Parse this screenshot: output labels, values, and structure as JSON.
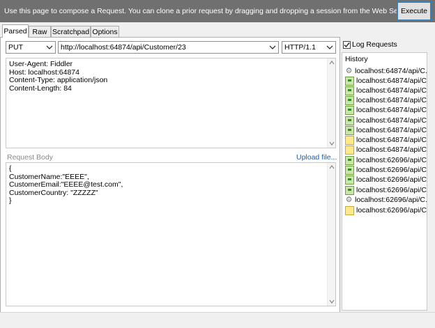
{
  "banner": {
    "text": "Use this page to compose a Request. You can clone a prior request by dragging and dropping a session from the Web Sessions list.",
    "execute_label": "Execute"
  },
  "tabs": [
    {
      "label": "Parsed",
      "active": true
    },
    {
      "label": "Raw",
      "active": false
    },
    {
      "label": "Scratchpad",
      "active": false
    },
    {
      "label": "Options",
      "active": false
    }
  ],
  "request_line": {
    "method": "PUT",
    "url": "http://localhost:64874/api/Customer/23",
    "version": "HTTP/1.1"
  },
  "headers_text": "User-Agent: Fiddler\nHost: localhost:64874\nContent-Type: application/json\nContent-Length: 84",
  "body": {
    "label": "Request Body",
    "upload_label": "Upload file...",
    "text": "{\nCustomerName:\"EEEE\",\nCustomerEmail:\"EEEE@test.com\",\nCustomerCountry: \"ZZZZZ\"\n}"
  },
  "log_requests": {
    "label": "Log Requests",
    "checked": true
  },
  "history": {
    "title": "History",
    "items": [
      {
        "label": "localhost:64874/api/C...",
        "icon": "gear-icon"
      },
      {
        "label": "localhost:64874/api/C...",
        "icon": "request-green-icon"
      },
      {
        "label": "localhost:64874/api/C...",
        "icon": "request-green-icon"
      },
      {
        "label": "localhost:64874/api/C...",
        "icon": "request-green-icon"
      },
      {
        "label": "localhost:64874/api/C...",
        "icon": "request-green-icon"
      },
      {
        "label": "localhost:64874/api/C...",
        "icon": "request-green-icon"
      },
      {
        "label": "localhost:64874/api/C...",
        "icon": "request-green-icon"
      },
      {
        "label": "localhost:64874/api/C...",
        "icon": "request-yellow-icon"
      },
      {
        "label": "localhost:64874/api/C...",
        "icon": "request-yellow-icon"
      },
      {
        "label": "localhost:62696/api/C...",
        "icon": "request-green-icon"
      },
      {
        "label": "localhost:62696/api/C...",
        "icon": "request-green-icon"
      },
      {
        "label": "localhost:62696/api/C...",
        "icon": "request-green-icon"
      },
      {
        "label": "localhost:62696/api/C...",
        "icon": "request-green-icon"
      },
      {
        "label": "localhost:62696/api/C...",
        "icon": "gear-icon"
      },
      {
        "label": "localhost:62696/api/C...",
        "icon": "request-yellow-icon"
      }
    ]
  },
  "colors": {
    "banner": "#707070",
    "execute_border": "#3c7fb1",
    "link": "#1a5fb4"
  }
}
